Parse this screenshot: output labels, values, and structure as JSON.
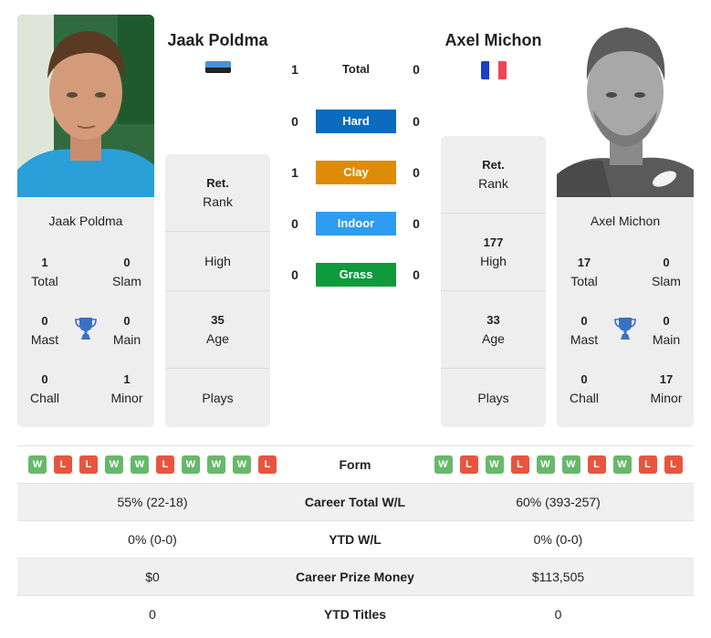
{
  "player1": {
    "name": "Jaak Poldma",
    "country_flag": "estonia-flag",
    "flag_colors": [
      "#4891d9",
      "#222222"
    ],
    "titles": {
      "total": {
        "value": "1",
        "label": "Total"
      },
      "slam": {
        "value": "0",
        "label": "Slam"
      },
      "mast": {
        "value": "0",
        "label": "Mast"
      },
      "main": {
        "value": "0",
        "label": "Main"
      },
      "chall": {
        "value": "0",
        "label": "Chall"
      },
      "minor": {
        "value": "1",
        "label": "Minor"
      }
    },
    "rank": {
      "value": "Ret.",
      "label": "Rank"
    },
    "high": {
      "value": "",
      "label": "High"
    },
    "age": {
      "value": "35",
      "label": "Age"
    },
    "plays": {
      "value": "",
      "label": "Plays"
    },
    "form": [
      "W",
      "L",
      "L",
      "W",
      "W",
      "L",
      "W",
      "W",
      "W",
      "L"
    ]
  },
  "player2": {
    "name": "Axel Michon",
    "country_flag": "france-flag",
    "flag_colors": [
      "#1a3fc4",
      "#ffffff",
      "#ef4455"
    ],
    "titles": {
      "total": {
        "value": "17",
        "label": "Total"
      },
      "slam": {
        "value": "0",
        "label": "Slam"
      },
      "mast": {
        "value": "0",
        "label": "Mast"
      },
      "main": {
        "value": "0",
        "label": "Main"
      },
      "chall": {
        "value": "0",
        "label": "Chall"
      },
      "minor": {
        "value": "17",
        "label": "Minor"
      }
    },
    "rank": {
      "value": "Ret.",
      "label": "Rank"
    },
    "high": {
      "value": "177",
      "label": "High"
    },
    "age": {
      "value": "33",
      "label": "Age"
    },
    "plays": {
      "value": "",
      "label": "Plays"
    },
    "form": [
      "W",
      "L",
      "W",
      "L",
      "W",
      "W",
      "L",
      "W",
      "L",
      "L"
    ]
  },
  "h2h": [
    {
      "label": "Total",
      "p1": "1",
      "p2": "0",
      "color": ""
    },
    {
      "label": "Hard",
      "p1": "0",
      "p2": "0",
      "color": "#0a6bbf"
    },
    {
      "label": "Clay",
      "p1": "1",
      "p2": "0",
      "color": "#de8c08"
    },
    {
      "label": "Indoor",
      "p1": "0",
      "p2": "0",
      "color": "#2e9cf0"
    },
    {
      "label": "Grass",
      "p1": "0",
      "p2": "0",
      "color": "#0f9a3c"
    }
  ],
  "table": {
    "form_label": "Form",
    "rows": [
      {
        "label": "Career Total W/L",
        "p1": "55% (22-18)",
        "p2": "60% (393-257)"
      },
      {
        "label": "YTD W/L",
        "p1": "0% (0-0)",
        "p2": "0% (0-0)"
      },
      {
        "label": "Career Prize Money",
        "p1": "$0",
        "p2": "$113,505"
      },
      {
        "label": "YTD Titles",
        "p1": "0",
        "p2": "0"
      }
    ]
  },
  "colors": {
    "win": "#68b86b",
    "loss": "#e8553f",
    "trophy": "#3b70c4",
    "card_bg": "#eeeeee"
  }
}
